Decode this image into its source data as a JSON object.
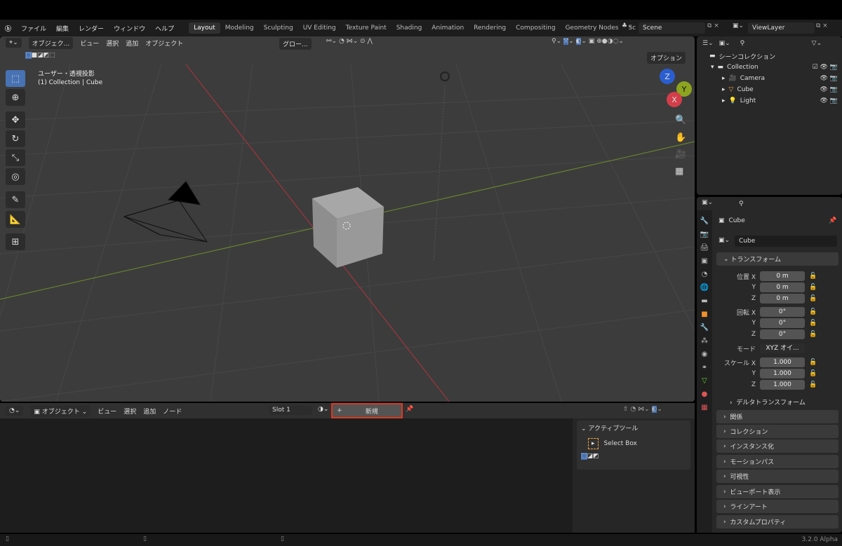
{
  "topbar": {
    "menus": [
      "ファイル",
      "編集",
      "レンダー",
      "ウィンドウ",
      "ヘルプ"
    ],
    "workspaces": [
      "Layout",
      "Modeling",
      "Sculpting",
      "UV Editing",
      "Texture Paint",
      "Shading",
      "Animation",
      "Rendering",
      "Compositing",
      "Geometry Nodes",
      "Sc"
    ],
    "active_workspace": "Layout",
    "scene": "Scene",
    "view_layer": "ViewLayer"
  },
  "viewport": {
    "mode": "オブジェク...",
    "menus": [
      "ビュー",
      "選択",
      "追加",
      "オブジェクト"
    ],
    "orientation": "グロー...",
    "options": "オプション",
    "view_name": "ユーザー・透視投影",
    "context": "(1) Collection | Cube",
    "gizmo": {
      "x": "X",
      "y": "Y",
      "z": "Z"
    }
  },
  "outliner": {
    "root": "シーンコレクション",
    "collection": "Collection",
    "items": [
      "Camera",
      "Cube",
      "Light"
    ]
  },
  "properties": {
    "object_name": "Cube",
    "data_name": "Cube",
    "transform_header": "トランスフォーム",
    "location": {
      "label": "位置",
      "x": "0 m",
      "y": "0 m",
      "z": "0 m"
    },
    "rotation": {
      "label": "回転",
      "x": "0°",
      "y": "0°",
      "z": "0°"
    },
    "mode": {
      "label": "モード",
      "value": "XYZ オイ..."
    },
    "scale": {
      "label": "スケール",
      "x": "1.000",
      "y": "1.000",
      "z": "1.000"
    },
    "axis": [
      "X",
      "Y",
      "Z"
    ],
    "delta": "デルタトランスフォーム",
    "sections": [
      "関係",
      "コレクション",
      "インスタンス化",
      "モーションパス",
      "可視性",
      "ビューポート表示",
      "ラインアート",
      "カスタムプロパティ"
    ]
  },
  "shader_editor": {
    "mode": "オブジェクト",
    "menus": [
      "ビュー",
      "選択",
      "追加",
      "ノード"
    ],
    "slot": "Slot 1",
    "new_button": "新規",
    "new_plus": "+",
    "highlight_color": "#e0361f",
    "active_tool_header": "アクティブツール",
    "active_tool": "Select Box"
  },
  "status": {
    "version": "3.2.0 Alpha"
  }
}
